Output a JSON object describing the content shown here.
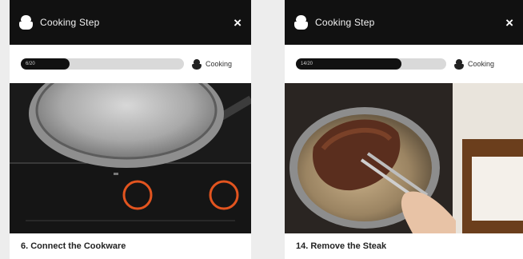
{
  "screens": [
    {
      "title": "Cooking Step",
      "close_symbol": "×",
      "progress": {
        "label": "6/20",
        "fraction": 0.3
      },
      "mode_label": "Cooking",
      "step_title": "6. Connect the Cookware"
    },
    {
      "title": "Cooking Step",
      "close_symbol": "×",
      "progress": {
        "label": "14/20",
        "fraction": 0.7
      },
      "mode_label": "Cooking",
      "step_title": "14. Remove the Steak"
    }
  ],
  "colors": {
    "header_bg": "#111111",
    "progress_fill": "#111111",
    "progress_track": "#d9d9d9",
    "burner_ring": "#e2541f"
  },
  "icons": {
    "header": "chef-icon",
    "close": "close-icon",
    "mode": "chef-icon"
  }
}
